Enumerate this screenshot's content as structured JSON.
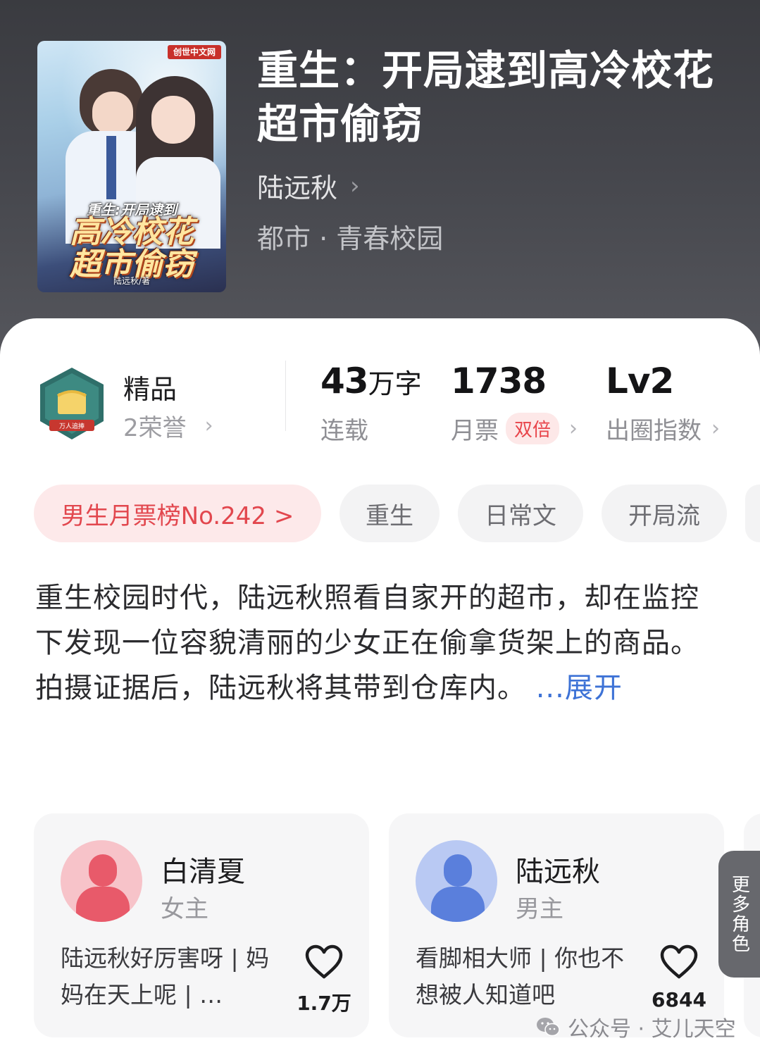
{
  "book": {
    "title": "重生：开局逮到高冷校花超市偷窃",
    "author": "陆远秋",
    "author_chevron": "›",
    "genre": "都市 · 青春校园",
    "cover": {
      "badge": "创世中文网",
      "title_small": "重生:开局逮到",
      "title_big_line1": "高冷校花",
      "title_big_line2": "超市偷窃",
      "author": "陆远秋/著"
    }
  },
  "honor": {
    "badge_text": "万人追捧",
    "title": "精品",
    "subtitle": "2荣誉",
    "chevron": "›"
  },
  "stats": {
    "words": {
      "number": "43",
      "unit": "万字",
      "label": "连载"
    },
    "monthly_votes": {
      "value": "1738",
      "label": "月票",
      "badge": "双倍",
      "chevron": "›"
    },
    "influence": {
      "value": "Lv2",
      "label": "出圈指数",
      "chevron": "›"
    }
  },
  "tags": {
    "rank": "男生月票榜No.242 >",
    "items": [
      "重生",
      "日常文",
      "开局流"
    ]
  },
  "description": {
    "text": "重生校园时代，陆远秋照看自家开的超市，却在监控下发现一位容貌清丽的少女正在偷拿货架上的商品。\n拍摄证据后，陆远秋将其带到仓库内。 ",
    "expand": "...展开"
  },
  "characters": [
    {
      "name": "白清夏",
      "role": "女主",
      "quote": "陆远秋好厉害呀 | 妈妈在天上呢 | …",
      "likes": "1.7万",
      "color": "#f07c88"
    },
    {
      "name": "陆远秋",
      "role": "男主",
      "quote": "看脚相大师 | 你也不想被人知道吧",
      "likes": "6844",
      "color": "#6f8fe0"
    }
  ],
  "more_roles": "更多角色",
  "watermark": "公众号 · 艾儿天空"
}
